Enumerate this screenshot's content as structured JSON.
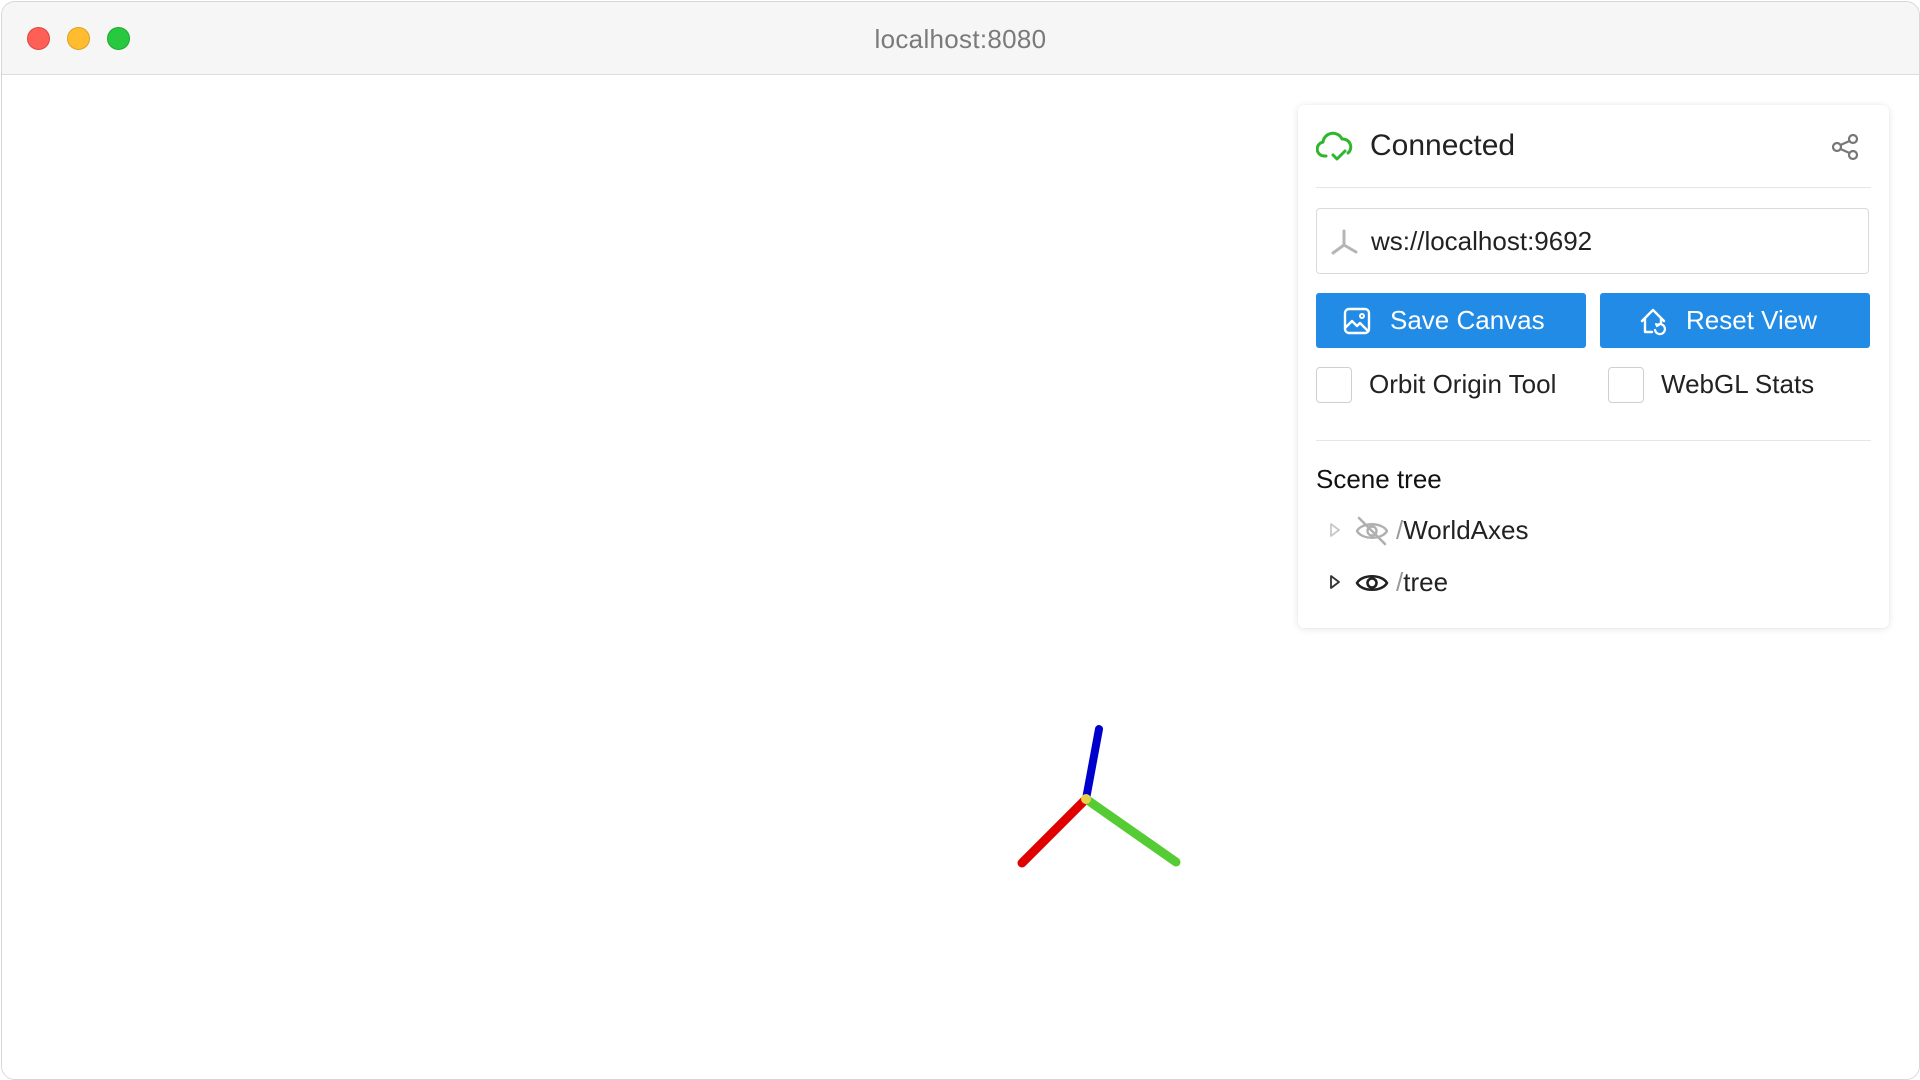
{
  "window": {
    "title": "localhost:8080"
  },
  "panel": {
    "status": "Connected",
    "server_url": "ws://localhost:9692",
    "buttons": {
      "save_label": "Save Canvas",
      "reset_label": "Reset View"
    },
    "checkboxes": {
      "orbit_label": "Orbit Origin Tool",
      "webgl_label": "WebGL Stats"
    },
    "scene_tree": {
      "title": "Scene tree",
      "nodes": [
        {
          "name": "WorldAxes",
          "visible": false
        },
        {
          "name": "tree",
          "visible": true
        }
      ]
    }
  },
  "colors": {
    "accent": "#228be6",
    "connected": "#2fb62f",
    "axis_x": "#e00000",
    "axis_y": "#55cc33",
    "axis_z": "#0000cc"
  },
  "icons": {
    "status": "cloud-check-icon",
    "share": "share-icon",
    "url": "axes-icon",
    "save": "photo-icon",
    "reset": "home-icon",
    "hidden": "eye-off-icon",
    "visible": "eye-icon"
  }
}
